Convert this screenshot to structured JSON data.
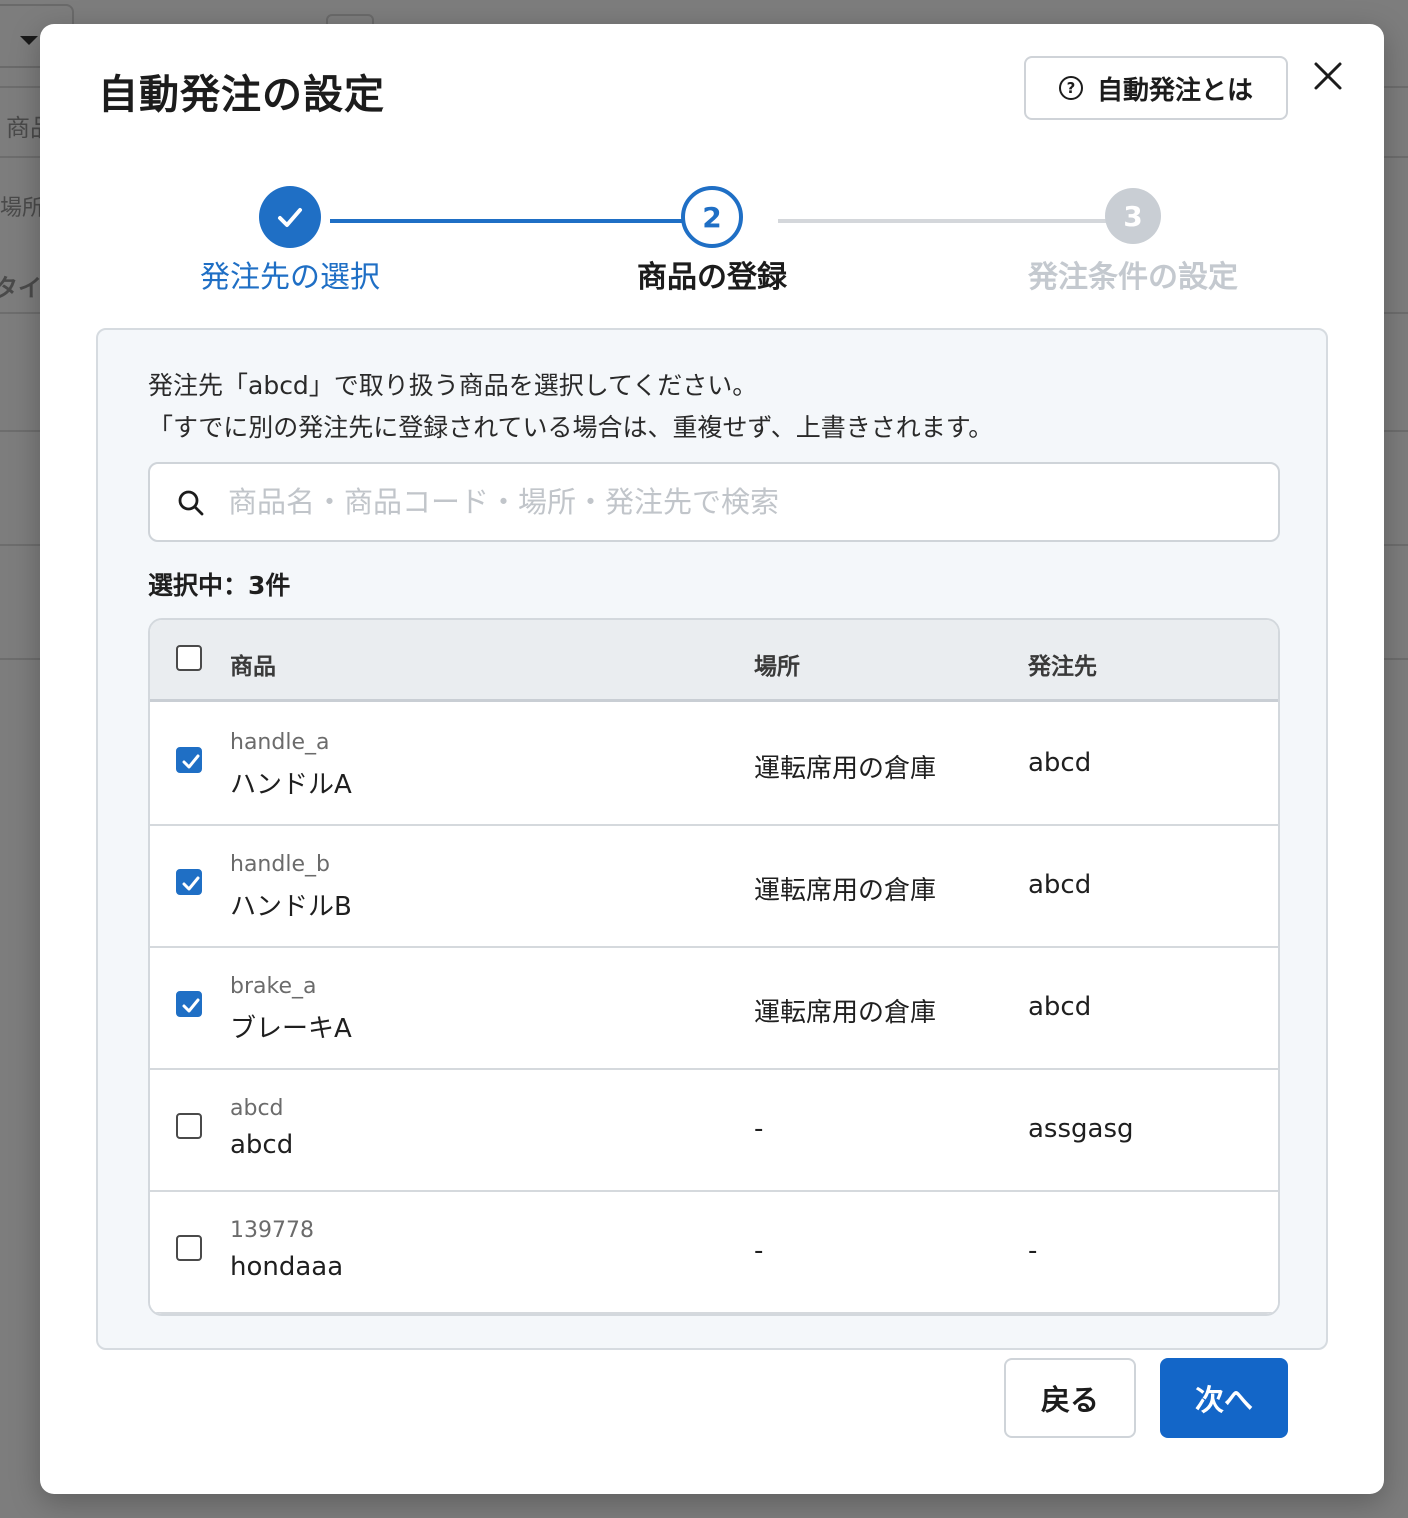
{
  "background": {
    "fragments": [
      "商品",
      "場所",
      "タイ"
    ]
  },
  "modal": {
    "title": "自動発注の設定",
    "help_button": "自動発注とは",
    "help_icon": "?",
    "close_icon": "close-icon"
  },
  "stepper": {
    "steps": [
      {
        "number": "1",
        "label": "発注先の選択",
        "state": "done"
      },
      {
        "number": "2",
        "label": "商品の登録",
        "state": "current"
      },
      {
        "number": "3",
        "label": "発注条件の設定",
        "state": "todo"
      }
    ]
  },
  "panel": {
    "description_line1": "発注先「abcd」で取り扱う商品を選択してください。",
    "description_line2": "「すでに別の発注先に登録されている場合は、重複せず、上書きされます。",
    "search_placeholder": "商品名・商品コード・場所・発注先で検索",
    "search_value": "",
    "selected_count": "選択中：3件"
  },
  "table": {
    "headers": {
      "product": "商品",
      "place": "場所",
      "vendor": "発注先"
    },
    "header_checked": false,
    "rows": [
      {
        "checked": true,
        "code": "handle_a",
        "name": "ハンドルA",
        "place": "運転席用の倉庫",
        "vendor": "abcd"
      },
      {
        "checked": true,
        "code": "handle_b",
        "name": "ハンドルB",
        "place": "運転席用の倉庫",
        "vendor": "abcd"
      },
      {
        "checked": true,
        "code": "brake_a",
        "name": "ブレーキA",
        "place": "運転席用の倉庫",
        "vendor": "abcd"
      },
      {
        "checked": false,
        "code": "abcd",
        "name": "abcd",
        "place": "-",
        "vendor": "assgasg"
      },
      {
        "checked": false,
        "code": "139778",
        "name": "hondaaa",
        "place": "-",
        "vendor": "-"
      }
    ]
  },
  "footer": {
    "back_label": "戻る",
    "next_label": "次へ"
  },
  "colors": {
    "accent": "#1f6fc5",
    "primary_button": "#1366c8",
    "step_inactive": "#c9ced4",
    "overlay": "#7d7d7d"
  }
}
